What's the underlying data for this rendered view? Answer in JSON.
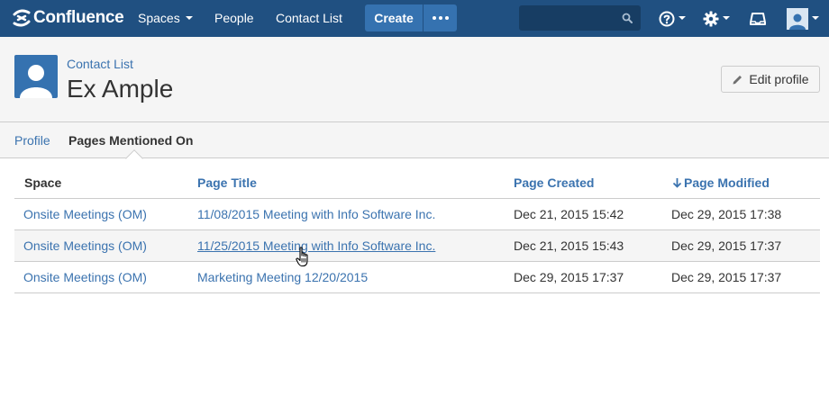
{
  "app": {
    "logo_text": "Confluence",
    "brand_color": "#205081",
    "link_color": "#3b73af"
  },
  "nav": {
    "spaces_label": "Spaces",
    "people_label": "People",
    "contact_list_label": "Contact List",
    "create_label": "Create",
    "more_icon": "ellipsis-icon",
    "search_placeholder": "",
    "help_icon": "help-icon",
    "settings_icon": "gear-icon",
    "notifications_icon": "notifications-icon",
    "user_icon": "user-avatar-icon"
  },
  "header": {
    "breadcrumb": "Contact List",
    "title": "Ex Ample",
    "edit_label": "Edit profile",
    "edit_icon": "pencil-icon"
  },
  "tabs": [
    {
      "label": "Profile",
      "active": false
    },
    {
      "label": "Pages Mentioned On",
      "active": true
    }
  ],
  "table": {
    "columns": {
      "space": "Space",
      "title": "Page Title",
      "created": "Page Created",
      "modified": "Page Modified"
    },
    "sort_icon": "arrow-down-icon",
    "rows": [
      {
        "space": "Onsite Meetings (OM)",
        "title": "11/08/2015 Meeting with Info Software Inc.",
        "created": "Dec 21, 2015 15:42",
        "modified": "Dec 29, 2015 17:38"
      },
      {
        "space": "Onsite Meetings (OM)",
        "title": "11/25/2015 Meeting with Info Software Inc.",
        "created": "Dec 21, 2015 15:43",
        "modified": "Dec 29, 2015 17:37"
      },
      {
        "space": "Onsite Meetings (OM)",
        "title": "Marketing Meeting 12/20/2015",
        "created": "Dec 29, 2015 17:37",
        "modified": "Dec 29, 2015 17:37"
      }
    ]
  }
}
